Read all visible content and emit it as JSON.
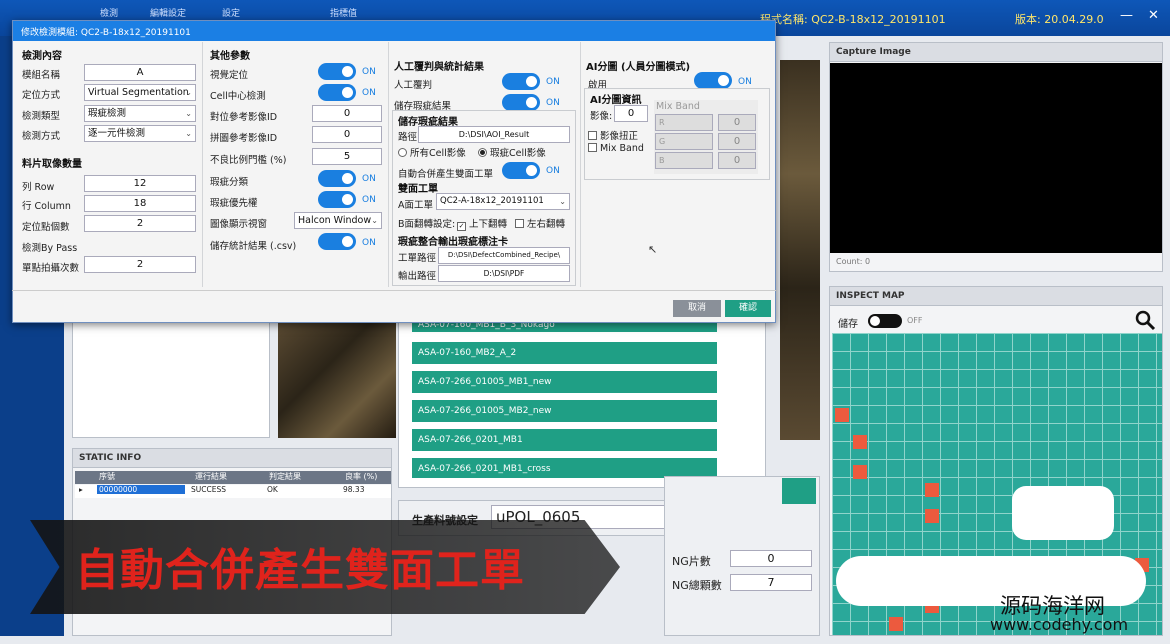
{
  "topbar": {
    "nav": [
      "檢測",
      "編輯設定",
      "設定",
      "指標值"
    ],
    "program_name": "程式名稱: QC2-B-18x12_20191101",
    "version": "版本: 20.04.29.0",
    "min": "—",
    "close": "✕"
  },
  "dialog": {
    "title": "修改檢測模組: QC2-B-18x12_20191101",
    "sec1": {
      "header": "檢測內容",
      "module_name_label": "模組名稱",
      "module_name": "A",
      "locate_label": "定位方式",
      "locate": "Virtual Segmentation",
      "type_label": "檢測類型",
      "type": "瑕疵檢測",
      "method_label": "檢測方式",
      "method": "逐一元件檢測"
    },
    "sec2": {
      "header": "料片取像數量",
      "row_label": "列 Row",
      "row": "12",
      "col_label": "行 Column",
      "col": "18",
      "points_label": "定位點個數",
      "points": "2",
      "bypass_label": "檢測By Pass",
      "shots_label": "單點拍攝次數",
      "shots": "2"
    },
    "sec3": {
      "header": "其他參數",
      "vision_label": "視覺定位",
      "cell_label": "Cell中心檢測",
      "align_label": "對位參考影像ID",
      "align": "0",
      "stitch_label": "拼圖參考影像ID",
      "stitch": "0",
      "ratio_label": "不良比例門檻 (%)",
      "ratio": "5",
      "classify_label": "瑕疵分類",
      "priority_label": "瑕疵優先權",
      "display_label": "圖像顯示視窗",
      "display": "Halcon Window",
      "csv_label": "儲存統計結果 (.csv)",
      "on": "ON"
    },
    "sec4": {
      "header": "人工覆判與統計結果",
      "review_label": "人工覆判",
      "save_defect_label": "儲存瑕疵結果",
      "save_defect_header": "儲存瑕疵結果",
      "path_label": "路徑",
      "path": "D:\\DSI\\AOI_Result",
      "radio_all": "所有Cell影像",
      "radio_defect": "瑕疵Cell影像",
      "auto_merge_label": "自動合併產生雙面工單",
      "double_header": "雙面工單",
      "a_label": "A面工單",
      "a_value": "QC2-A-18x12_20191101",
      "flip_label": "B面翻轉設定:",
      "flip_ud": "上下翻轉",
      "flip_lr": "左右翻轉",
      "merge_header": "瑕疵整合輸出瑕疵標注卡",
      "recipe_path_label": "工單路徑",
      "recipe_path": "D:\\DSI\\DefectCombined_Recipe\\",
      "out_path_label": "輸出路徑",
      "out_path": "D:\\DSI\\PDF"
    },
    "sec5": {
      "header": "AI分圖 (人員分圖模式)",
      "enable_label": "啟用",
      "info_header": "AI分圖資訊",
      "image_label": "影像:",
      "image": "0",
      "mixband_title": "Mix Band",
      "rotate_label": "影像扭正",
      "mixband_label": "Mix Band",
      "bands": [
        "R",
        "G",
        "B"
      ],
      "band_vals": [
        "0",
        "0",
        "0"
      ]
    },
    "cancel": "取消",
    "confirm": "確認"
  },
  "capture": {
    "title": "Capture Image",
    "count": "Count: 0"
  },
  "inspect": {
    "title": "INSPECT MAP",
    "save_label": "儲存",
    "off": "OFF"
  },
  "static": {
    "title": "STATIC INFO",
    "cols": [
      "序號",
      "運行結果",
      "判定結果",
      "良率 (%)"
    ],
    "row": [
      "00000000",
      "SUCCESS",
      "OK",
      "98.33"
    ]
  },
  "recipes": [
    "ASA-07-160_MB1_B_3_Nokago",
    "ASA-07-160_MB2_A_2",
    "ASA-07-266_01005_MB1_new",
    "ASA-07-266_01005_MB2_new",
    "ASA-07-266_0201_MB1",
    "ASA-07-266_0201_MB1_cross"
  ],
  "material": {
    "label": "生產料號設定",
    "value": "uPOL_0605"
  },
  "ng": {
    "pieces_label": "NG片數",
    "pieces": "0",
    "grains_label": "NG總顆數",
    "grains": "7"
  },
  "banner": {
    "text": "自動合併產生雙面工單"
  },
  "watermark": {
    "line1": "源码海洋网",
    "line2": "www.codehy.com"
  },
  "colors": {
    "accent": "#1a7fe0",
    "teal": "#1f9f85",
    "map_bg": "#2aa89a",
    "defect": "#ec5a3e"
  }
}
